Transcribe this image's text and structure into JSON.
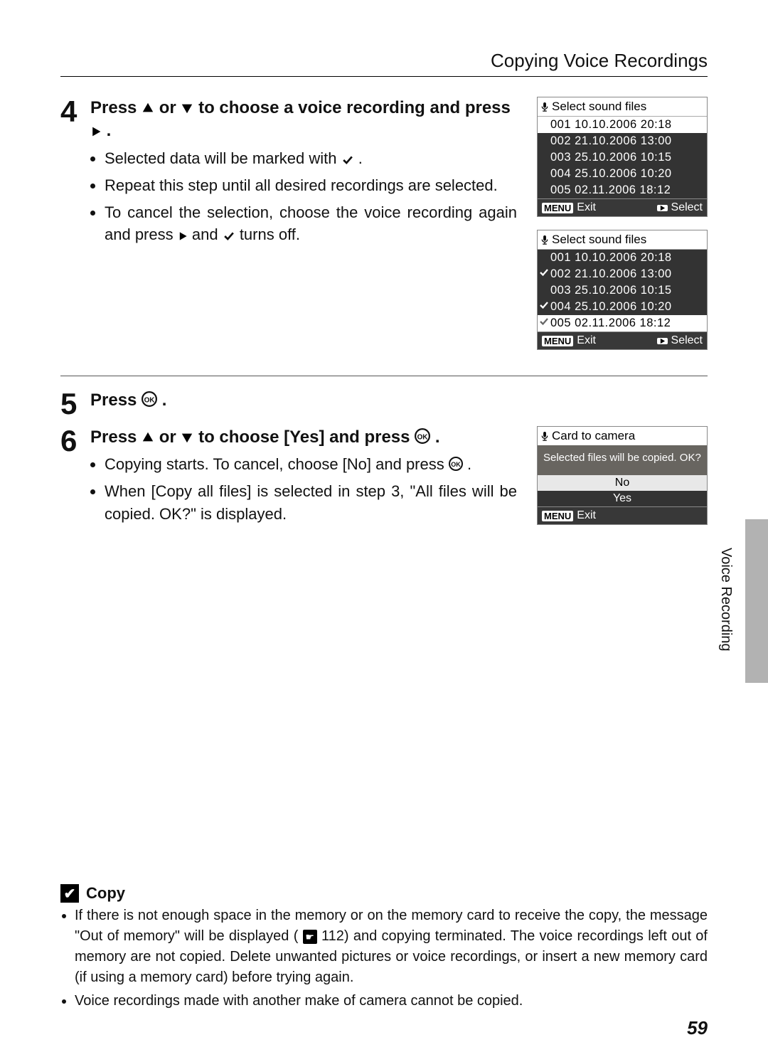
{
  "header": {
    "title": "Copying Voice Recordings"
  },
  "step4": {
    "num": "4",
    "heading_a": "Press ",
    "heading_b": " or ",
    "heading_c": " to choose a voice recording and press ",
    "heading_d": ".",
    "bullet1_a": "Selected data will be marked with ",
    "bullet1_b": ".",
    "bullet2": "Repeat this step until all desired recordings are selected.",
    "bullet3_a": "To cancel the selection, choose the voice recording again and press ",
    "bullet3_b": " and ",
    "bullet3_c": " turns off."
  },
  "step5": {
    "num": "5",
    "heading_a": "Press ",
    "heading_b": "."
  },
  "step6": {
    "num": "6",
    "heading_a": "Press ",
    "heading_b": " or ",
    "heading_c": " to choose [Yes] and press ",
    "heading_d": ".",
    "bullet1_a": "Copying starts. To cancel, choose [No] and press ",
    "bullet1_b": ".",
    "bullet2": "When [Copy all files] is selected in step 3, \"All files will be copied. OK?\" is displayed."
  },
  "lcd1": {
    "title": "Select sound files",
    "rows": [
      {
        "text": "001 10.10.2006 20:18",
        "dark": false,
        "check": false
      },
      {
        "text": "002 21.10.2006 13:00",
        "dark": true,
        "check": false
      },
      {
        "text": "003 25.10.2006 10:15",
        "dark": true,
        "check": false
      },
      {
        "text": "004 25.10.2006 10:20",
        "dark": true,
        "check": false
      },
      {
        "text": "005 02.11.2006 18:12",
        "dark": true,
        "check": false
      }
    ],
    "footer": {
      "menu": "MENU",
      "exit": "Exit",
      "select": "Select"
    }
  },
  "lcd2": {
    "title": "Select sound files",
    "rows": [
      {
        "text": "001 10.10.2006 20:18",
        "dark": true,
        "check": false
      },
      {
        "text": "002 21.10.2006 13:00",
        "dark": true,
        "check": true
      },
      {
        "text": "003 25.10.2006 10:15",
        "dark": true,
        "check": false
      },
      {
        "text": "004 25.10.2006 10:20",
        "dark": true,
        "check": true
      },
      {
        "text": "005 02.11.2006 18:12",
        "dark": false,
        "check": true
      }
    ],
    "footer": {
      "menu": "MENU",
      "exit": "Exit",
      "select": "Select"
    }
  },
  "lcd3": {
    "title": "Card to camera",
    "msg": "Selected files will be copied. OK?",
    "opt_no": "No",
    "opt_yes": "Yes",
    "footer": {
      "menu": "MENU",
      "exit": "Exit"
    }
  },
  "side_label": "Voice Recording",
  "note": {
    "title": "Copy",
    "bullet1_a": "If there is not enough space in the memory or on the memory card to receive the copy, the message \"Out of memory\" will be displayed (",
    "bullet1_b": " 112) and copying terminated. The voice recordings left out of memory are not copied. Delete unwanted pictures or voice recordings, or insert a new memory card (if using a memory card) before trying again.",
    "bullet2": "Voice recordings made with another make of camera cannot be copied."
  },
  "page_num": "59"
}
